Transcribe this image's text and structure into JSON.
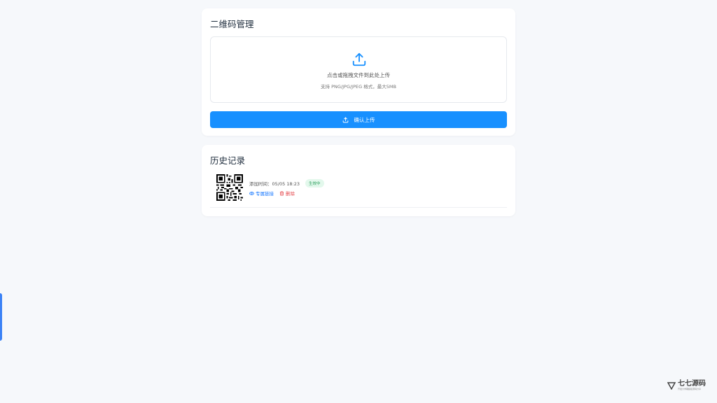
{
  "upload_card": {
    "title": "二维码管理",
    "dropzone_text": "点击或拖拽文件到此处上传",
    "dropzone_hint": "支持 PNG/JPG/JPEG 格式，最大5MB",
    "confirm_button": "确认上传"
  },
  "history_card": {
    "title": "历史记录",
    "items": [
      {
        "added_time": "添加时间：05/05 18:23",
        "status": "生效中",
        "link_label": "专属链接",
        "delete_label": "删除"
      }
    ]
  },
  "watermark": {
    "brand": "七七源码",
    "tagline": "开发大学期超级源码分享"
  },
  "colors": {
    "primary": "#1890ff",
    "background": "#f6f8fb",
    "status_active": "#2a9d5b",
    "danger": "#e5484d"
  },
  "icons": {
    "upload": "upload-icon",
    "link": "eye-icon",
    "delete": "trash-icon"
  }
}
